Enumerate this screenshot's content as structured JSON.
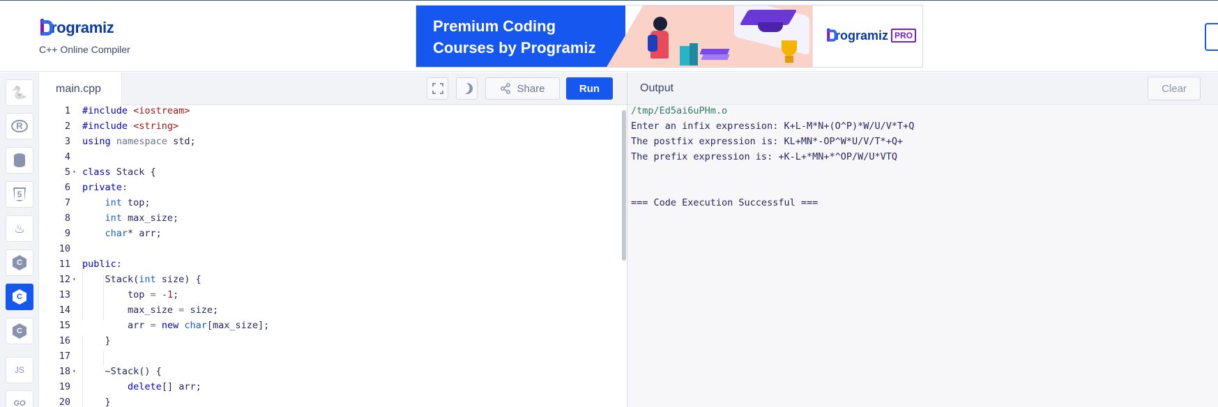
{
  "header": {
    "logo_text": "rogramiz",
    "subtitle": "C++ Online Compiler"
  },
  "banner": {
    "title": "Premium Coding Courses by Programiz",
    "brand": "rogramiz",
    "badge": "PRO"
  },
  "sidebar": {
    "items": [
      {
        "name": "python",
        "glyph": "🐍",
        "active": false
      },
      {
        "name": "r",
        "glyph": "R",
        "active": false
      },
      {
        "name": "sql",
        "glyph": "",
        "active": false
      },
      {
        "name": "html",
        "glyph": "5",
        "active": false
      },
      {
        "name": "java",
        "glyph": "♨",
        "active": false
      },
      {
        "name": "c",
        "glyph": "C",
        "active": false
      },
      {
        "name": "cpp",
        "glyph": "C",
        "active": true
      },
      {
        "name": "csharp",
        "glyph": "C",
        "active": false
      },
      {
        "name": "js",
        "glyph": "JS",
        "active": false
      },
      {
        "name": "go",
        "glyph": "GO",
        "active": false
      }
    ]
  },
  "editor": {
    "file_tab": "main.cpp",
    "share_label": "Share",
    "run_label": "Run",
    "lines": [
      {
        "n": "1",
        "fold": false,
        "tokens": [
          [
            "#include ",
            "#0000cc"
          ],
          [
            "<iostream>",
            "#a11"
          ]
        ]
      },
      {
        "n": "2",
        "fold": false,
        "tokens": [
          [
            "#include ",
            "#0000cc"
          ],
          [
            "<string>",
            "#a11"
          ]
        ]
      },
      {
        "n": "3",
        "fold": false,
        "tokens": [
          [
            "using ",
            "#0000cc"
          ],
          [
            "namespace ",
            "#6b7391"
          ],
          [
            "std;",
            "#25265e"
          ]
        ]
      },
      {
        "n": "4",
        "fold": false,
        "tokens": []
      },
      {
        "n": "5",
        "fold": true,
        "tokens": [
          [
            "class ",
            "#0000cc"
          ],
          [
            "Stack {",
            "#25265e"
          ]
        ]
      },
      {
        "n": "6",
        "fold": false,
        "tokens": [
          [
            "private",
            "#0000cc"
          ],
          [
            ":",
            "#25265e"
          ]
        ]
      },
      {
        "n": "7",
        "fold": false,
        "tokens": [
          [
            "    ",
            "#25265e"
          ],
          [
            "int ",
            "#1a5fc7"
          ],
          [
            "top;",
            "#25265e"
          ]
        ]
      },
      {
        "n": "8",
        "fold": false,
        "tokens": [
          [
            "    ",
            "#25265e"
          ],
          [
            "int ",
            "#1a5fc7"
          ],
          [
            "max_size;",
            "#25265e"
          ]
        ]
      },
      {
        "n": "9",
        "fold": false,
        "tokens": [
          [
            "    ",
            "#25265e"
          ],
          [
            "char",
            "#1a5fc7"
          ],
          [
            "* ",
            "#25265e"
          ],
          [
            "arr;",
            "#25265e"
          ]
        ]
      },
      {
        "n": "10",
        "fold": false,
        "tokens": []
      },
      {
        "n": "11",
        "fold": false,
        "tokens": [
          [
            "public",
            "#0000cc"
          ],
          [
            ":",
            "#25265e"
          ]
        ]
      },
      {
        "n": "12",
        "fold": true,
        "tokens": [
          [
            "    Stack(",
            "#25265e"
          ],
          [
            "int ",
            "#1a5fc7"
          ],
          [
            "size) {",
            "#25265e"
          ]
        ]
      },
      {
        "n": "13",
        "fold": false,
        "tokens": [
          [
            "        top ",
            "#25265e"
          ],
          [
            "= ",
            "#6b7391"
          ],
          [
            "-1",
            "#a11"
          ],
          [
            ";",
            "#25265e"
          ]
        ]
      },
      {
        "n": "14",
        "fold": false,
        "tokens": [
          [
            "        max_size ",
            "#25265e"
          ],
          [
            "= ",
            "#6b7391"
          ],
          [
            "size;",
            "#25265e"
          ]
        ]
      },
      {
        "n": "15",
        "fold": false,
        "tokens": [
          [
            "        arr ",
            "#25265e"
          ],
          [
            "= ",
            "#6b7391"
          ],
          [
            "new ",
            "#0000cc"
          ],
          [
            "char",
            "#1a5fc7"
          ],
          [
            "[max_size];",
            "#25265e"
          ]
        ]
      },
      {
        "n": "16",
        "fold": false,
        "tokens": [
          [
            "    }",
            "#25265e"
          ]
        ]
      },
      {
        "n": "17",
        "fold": false,
        "tokens": []
      },
      {
        "n": "18",
        "fold": true,
        "tokens": [
          [
            "    ~Stack() {",
            "#25265e"
          ]
        ]
      },
      {
        "n": "19",
        "fold": false,
        "tokens": [
          [
            "        ",
            "#25265e"
          ],
          [
            "delete",
            "#0000cc"
          ],
          [
            "[] arr;",
            "#25265e"
          ]
        ]
      },
      {
        "n": "20",
        "fold": false,
        "tokens": [
          [
            "    }",
            "#25265e"
          ]
        ]
      }
    ]
  },
  "output": {
    "title": "Output",
    "clear_label": "Clear",
    "lines": [
      {
        "text": "/tmp/Ed5ai6uPHm.o",
        "color": "#2e7d5b"
      },
      {
        "text": "Enter an infix expression: K+L-M*N+(O^P)*W/U/V*T+Q",
        "color": "#25265e"
      },
      {
        "text": "The postfix expression is: KL+MN*-OP^W*U/V/T*+Q+",
        "color": "#25265e"
      },
      {
        "text": "The prefix expression is: +K-L+*MN+*^OP/W/U*VTQ",
        "color": "#25265e"
      },
      {
        "text": "",
        "color": "#25265e"
      },
      {
        "text": "",
        "color": "#25265e"
      },
      {
        "text": "=== Code Execution Successful ===",
        "color": "#25265e"
      }
    ]
  },
  "colors": {
    "accent": "#1657f0",
    "brand_purple": "#7a1cc4",
    "brand_blue": "#0b3aa8"
  }
}
